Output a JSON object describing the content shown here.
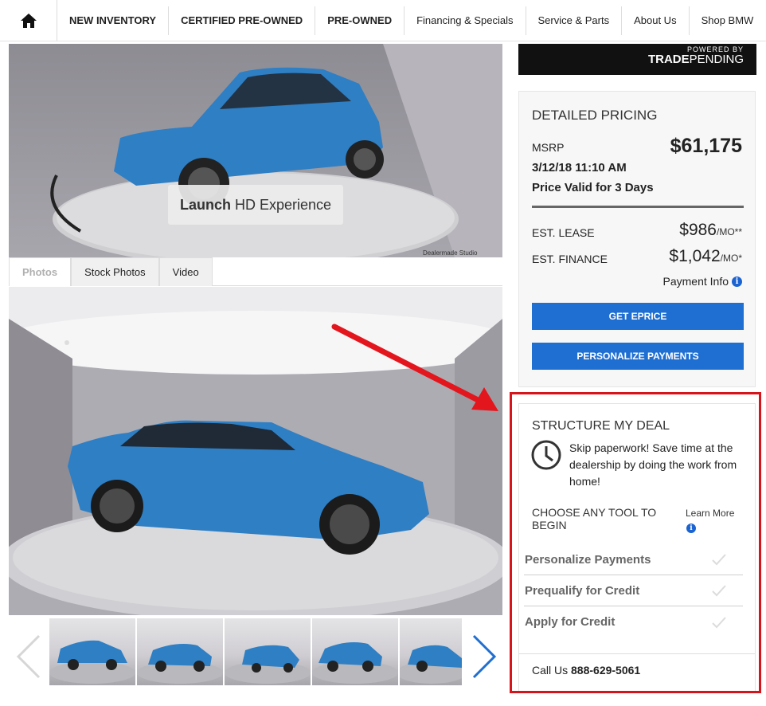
{
  "nav": {
    "items": [
      {
        "label": "NEW INVENTORY",
        "bold": true
      },
      {
        "label": "CERTIFIED PRE-OWNED",
        "bold": true
      },
      {
        "label": "PRE-OWNED",
        "bold": true
      },
      {
        "label": "Financing & Specials",
        "bold": false
      },
      {
        "label": "Service & Parts",
        "bold": false
      },
      {
        "label": "About Us",
        "bold": false
      },
      {
        "label": "Shop BMW",
        "bold": false
      }
    ],
    "home_icon": "home-icon"
  },
  "hero": {
    "launch_bold": "Launch",
    "launch_rest": "HD Experience",
    "watermark": "Dealermade Studio"
  },
  "tabs": [
    "Photos",
    "Stock Photos",
    "Video"
  ],
  "thumbnails": {
    "count": 5,
    "prev_icon": "chevron-left-icon",
    "next_icon": "chevron-right-icon"
  },
  "trade_banner": {
    "powered_by": "POWERED BY",
    "brand_bold": "TRADE",
    "brand_rest": "PENDING"
  },
  "pricing": {
    "title": "DETAILED PRICING",
    "msrp_label": "MSRP",
    "msrp": "$61,175",
    "date": "3/12/18 11:10 AM",
    "valid": "Price Valid for 3 Days",
    "lease_label": "EST. LEASE",
    "lease_value": "$986",
    "lease_suffix": "/MO**",
    "finance_label": "EST. FINANCE",
    "finance_value": "$1,042",
    "finance_suffix": "/MO*",
    "payment_info": "Payment Info",
    "btn_eprice": "GET EPRICE",
    "btn_personalize": "PERSONALIZE PAYMENTS"
  },
  "deal": {
    "title": "STRUCTURE MY DEAL",
    "text": "Skip paperwork! Save time at the dealership by doing the work from home!",
    "choose": "CHOOSE ANY TOOL TO BEGIN",
    "learn_more": "Learn More",
    "tools": [
      "Personalize Payments",
      "Prequalify for Credit",
      "Apply for Credit"
    ],
    "call_label": "Call Us",
    "phone": "888-629-5061"
  },
  "colors": {
    "button_blue": "#1f6fd2",
    "highlight_red": "#d6141c",
    "car_blue": "#2f7fc4"
  }
}
